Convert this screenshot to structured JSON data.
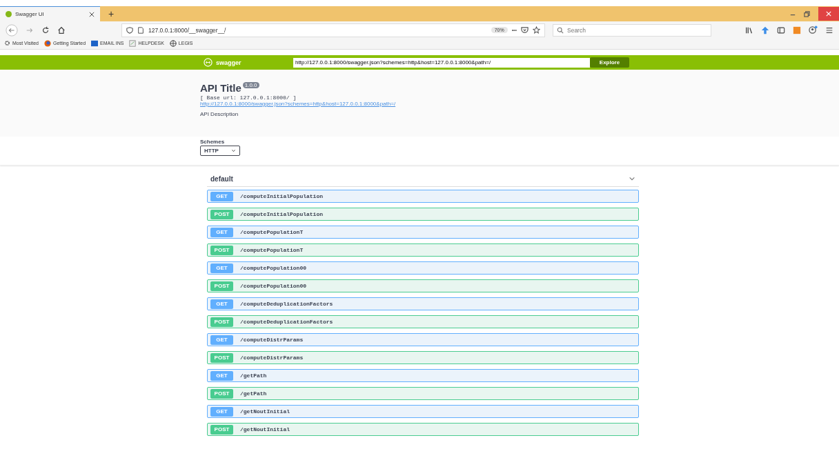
{
  "browser": {
    "tab_title": "Swagger UI",
    "new_tab": "+",
    "url": "127.0.0.1:8000/__swagger__/",
    "zoom": "70%",
    "more": "•••",
    "search_placeholder": "Search",
    "bookmarks": [
      {
        "label": "Most Visited",
        "kind": "gear"
      },
      {
        "label": "Getting Started",
        "kind": "firefox"
      },
      {
        "label": "EMAIL INS",
        "kind": "mail"
      },
      {
        "label": "HELPDESK",
        "kind": "doc"
      },
      {
        "label": "LEGIS",
        "kind": "globe"
      }
    ]
  },
  "topbar": {
    "logo": "swagger",
    "spec_url": "http://127.0.0.1:8000/swagger.json?schemes=http&host=127.0.0.1:8000&path=/",
    "explore": "Explore"
  },
  "info": {
    "title": "API Title",
    "version": "1.0.0",
    "base_url": "[ Base url: 127.0.0.1:8000/ ]",
    "link": "http://127.0.0.1:8000/swagger.json?schemes=http&host=127.0.0.1:8000&path=/",
    "description": "API Description"
  },
  "schemes": {
    "label": "Schemes",
    "value": "HTTP"
  },
  "section": {
    "name": "default",
    "expanded": true
  },
  "operations": [
    {
      "method": "GET",
      "path": "/computeInitialPopulation"
    },
    {
      "method": "POST",
      "path": "/computeInitialPopulation"
    },
    {
      "method": "GET",
      "path": "/computePopulationT"
    },
    {
      "method": "POST",
      "path": "/computePopulationT"
    },
    {
      "method": "GET",
      "path": "/computePopulation00"
    },
    {
      "method": "POST",
      "path": "/computePopulation00"
    },
    {
      "method": "GET",
      "path": "/computeDeduplicationFactors"
    },
    {
      "method": "POST",
      "path": "/computeDeduplicationFactors"
    },
    {
      "method": "GET",
      "path": "/computeDistrParams"
    },
    {
      "method": "POST",
      "path": "/computeDistrParams"
    },
    {
      "method": "GET",
      "path": "/getPath"
    },
    {
      "method": "POST",
      "path": "/getPath"
    },
    {
      "method": "GET",
      "path": "/getNoutInitial"
    },
    {
      "method": "POST",
      "path": "/getNoutInitial"
    }
  ]
}
